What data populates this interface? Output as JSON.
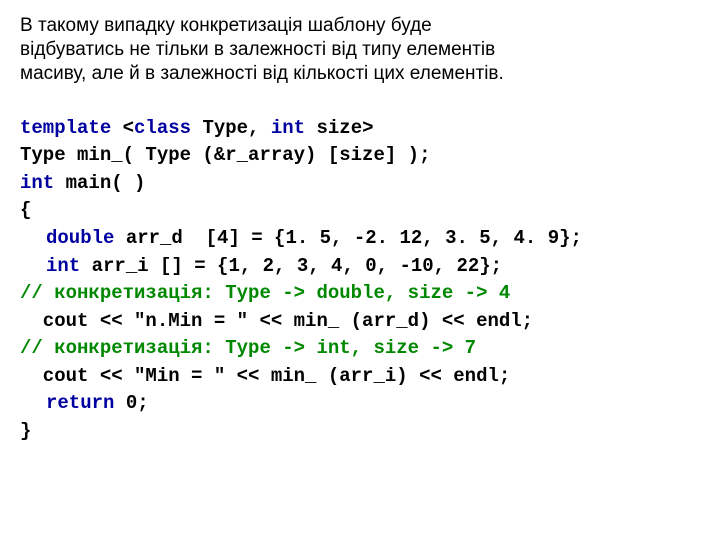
{
  "intro": {
    "l1": "В такому випадку конкретизація шаблону буде",
    "l2": "відбуватись не тільки в залежності від типу елементів",
    "l3": "масиву, але й в залежності від кількості цих елементів."
  },
  "code": {
    "l1a": "template",
    "l1b": " <",
    "l1c": "class",
    "l1d": " Type, ",
    "l1e": "int",
    "l1f": " size>",
    "l2": "Type min_( Type (&r_array) [size] );",
    "l3a": "int",
    "l3b": " main( )",
    "l4": "{",
    "l5a": "double",
    "l5b": " arr_d  [4] = {1. 5, -2. 12, 3. 5, 4. 9};",
    "l6a": "int",
    "l6b": " arr_i [] = {1, 2, 3, 4, 0, -10, 22};",
    "l7": "// конкретизація: Type -> double, size -> 4",
    "l8": "  cout << \"n.Min = \" << min_ (arr_d) << endl;",
    "l9": "// конкретизація: Type -> int, size -> 7",
    "l10": "  cout << \"Min = \" << min_ (arr_i) << endl;",
    "l11a": "return",
    "l11b": " 0;",
    "l12": "}"
  }
}
